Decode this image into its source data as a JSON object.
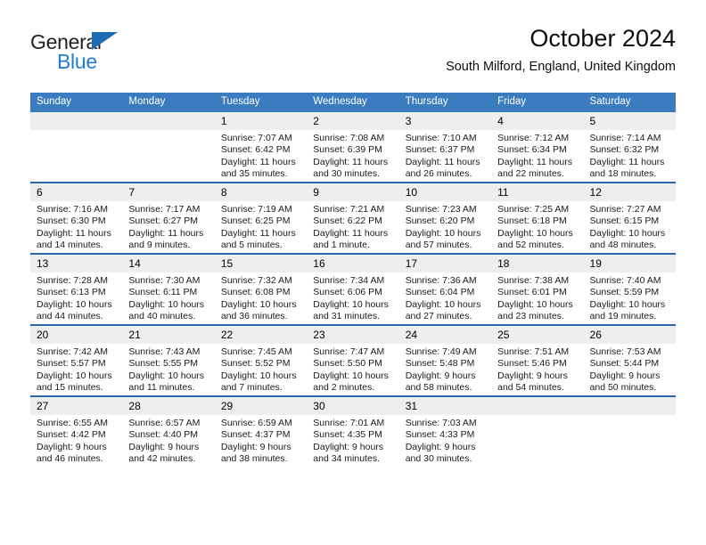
{
  "logo": {
    "word_top": "General",
    "word_bottom": "Blue",
    "triangle_icon": "triangle-icon",
    "color_dark": "#231f20",
    "color_blue": "#1c7fd4"
  },
  "header": {
    "title": "October 2024",
    "subtitle": "South Milford, England, United Kingdom"
  },
  "theme": {
    "header_bar": "#3a7cbe",
    "row_divider": "#2a6aac",
    "daynum_band": "#eeeeee"
  },
  "calendar": {
    "weekday_headers": [
      "Sunday",
      "Monday",
      "Tuesday",
      "Wednesday",
      "Thursday",
      "Friday",
      "Saturday"
    ],
    "weeks": [
      [
        {
          "day": "",
          "lines": []
        },
        {
          "day": "",
          "lines": []
        },
        {
          "day": "1",
          "lines": [
            "Sunrise: 7:07 AM",
            "Sunset: 6:42 PM",
            "Daylight: 11 hours",
            "and 35 minutes."
          ]
        },
        {
          "day": "2",
          "lines": [
            "Sunrise: 7:08 AM",
            "Sunset: 6:39 PM",
            "Daylight: 11 hours",
            "and 30 minutes."
          ]
        },
        {
          "day": "3",
          "lines": [
            "Sunrise: 7:10 AM",
            "Sunset: 6:37 PM",
            "Daylight: 11 hours",
            "and 26 minutes."
          ]
        },
        {
          "day": "4",
          "lines": [
            "Sunrise: 7:12 AM",
            "Sunset: 6:34 PM",
            "Daylight: 11 hours",
            "and 22 minutes."
          ]
        },
        {
          "day": "5",
          "lines": [
            "Sunrise: 7:14 AM",
            "Sunset: 6:32 PM",
            "Daylight: 11 hours",
            "and 18 minutes."
          ]
        }
      ],
      [
        {
          "day": "6",
          "lines": [
            "Sunrise: 7:16 AM",
            "Sunset: 6:30 PM",
            "Daylight: 11 hours",
            "and 14 minutes."
          ]
        },
        {
          "day": "7",
          "lines": [
            "Sunrise: 7:17 AM",
            "Sunset: 6:27 PM",
            "Daylight: 11 hours",
            "and 9 minutes."
          ]
        },
        {
          "day": "8",
          "lines": [
            "Sunrise: 7:19 AM",
            "Sunset: 6:25 PM",
            "Daylight: 11 hours",
            "and 5 minutes."
          ]
        },
        {
          "day": "9",
          "lines": [
            "Sunrise: 7:21 AM",
            "Sunset: 6:22 PM",
            "Daylight: 11 hours",
            "and 1 minute."
          ]
        },
        {
          "day": "10",
          "lines": [
            "Sunrise: 7:23 AM",
            "Sunset: 6:20 PM",
            "Daylight: 10 hours",
            "and 57 minutes."
          ]
        },
        {
          "day": "11",
          "lines": [
            "Sunrise: 7:25 AM",
            "Sunset: 6:18 PM",
            "Daylight: 10 hours",
            "and 52 minutes."
          ]
        },
        {
          "day": "12",
          "lines": [
            "Sunrise: 7:27 AM",
            "Sunset: 6:15 PM",
            "Daylight: 10 hours",
            "and 48 minutes."
          ]
        }
      ],
      [
        {
          "day": "13",
          "lines": [
            "Sunrise: 7:28 AM",
            "Sunset: 6:13 PM",
            "Daylight: 10 hours",
            "and 44 minutes."
          ]
        },
        {
          "day": "14",
          "lines": [
            "Sunrise: 7:30 AM",
            "Sunset: 6:11 PM",
            "Daylight: 10 hours",
            "and 40 minutes."
          ]
        },
        {
          "day": "15",
          "lines": [
            "Sunrise: 7:32 AM",
            "Sunset: 6:08 PM",
            "Daylight: 10 hours",
            "and 36 minutes."
          ]
        },
        {
          "day": "16",
          "lines": [
            "Sunrise: 7:34 AM",
            "Sunset: 6:06 PM",
            "Daylight: 10 hours",
            "and 31 minutes."
          ]
        },
        {
          "day": "17",
          "lines": [
            "Sunrise: 7:36 AM",
            "Sunset: 6:04 PM",
            "Daylight: 10 hours",
            "and 27 minutes."
          ]
        },
        {
          "day": "18",
          "lines": [
            "Sunrise: 7:38 AM",
            "Sunset: 6:01 PM",
            "Daylight: 10 hours",
            "and 23 minutes."
          ]
        },
        {
          "day": "19",
          "lines": [
            "Sunrise: 7:40 AM",
            "Sunset: 5:59 PM",
            "Daylight: 10 hours",
            "and 19 minutes."
          ]
        }
      ],
      [
        {
          "day": "20",
          "lines": [
            "Sunrise: 7:42 AM",
            "Sunset: 5:57 PM",
            "Daylight: 10 hours",
            "and 15 minutes."
          ]
        },
        {
          "day": "21",
          "lines": [
            "Sunrise: 7:43 AM",
            "Sunset: 5:55 PM",
            "Daylight: 10 hours",
            "and 11 minutes."
          ]
        },
        {
          "day": "22",
          "lines": [
            "Sunrise: 7:45 AM",
            "Sunset: 5:52 PM",
            "Daylight: 10 hours",
            "and 7 minutes."
          ]
        },
        {
          "day": "23",
          "lines": [
            "Sunrise: 7:47 AM",
            "Sunset: 5:50 PM",
            "Daylight: 10 hours",
            "and 2 minutes."
          ]
        },
        {
          "day": "24",
          "lines": [
            "Sunrise: 7:49 AM",
            "Sunset: 5:48 PM",
            "Daylight: 9 hours",
            "and 58 minutes."
          ]
        },
        {
          "day": "25",
          "lines": [
            "Sunrise: 7:51 AM",
            "Sunset: 5:46 PM",
            "Daylight: 9 hours",
            "and 54 minutes."
          ]
        },
        {
          "day": "26",
          "lines": [
            "Sunrise: 7:53 AM",
            "Sunset: 5:44 PM",
            "Daylight: 9 hours",
            "and 50 minutes."
          ]
        }
      ],
      [
        {
          "day": "27",
          "lines": [
            "Sunrise: 6:55 AM",
            "Sunset: 4:42 PM",
            "Daylight: 9 hours",
            "and 46 minutes."
          ]
        },
        {
          "day": "28",
          "lines": [
            "Sunrise: 6:57 AM",
            "Sunset: 4:40 PM",
            "Daylight: 9 hours",
            "and 42 minutes."
          ]
        },
        {
          "day": "29",
          "lines": [
            "Sunrise: 6:59 AM",
            "Sunset: 4:37 PM",
            "Daylight: 9 hours",
            "and 38 minutes."
          ]
        },
        {
          "day": "30",
          "lines": [
            "Sunrise: 7:01 AM",
            "Sunset: 4:35 PM",
            "Daylight: 9 hours",
            "and 34 minutes."
          ]
        },
        {
          "day": "31",
          "lines": [
            "Sunrise: 7:03 AM",
            "Sunset: 4:33 PM",
            "Daylight: 9 hours",
            "and 30 minutes."
          ]
        },
        {
          "day": "",
          "lines": []
        },
        {
          "day": "",
          "lines": []
        }
      ]
    ]
  }
}
